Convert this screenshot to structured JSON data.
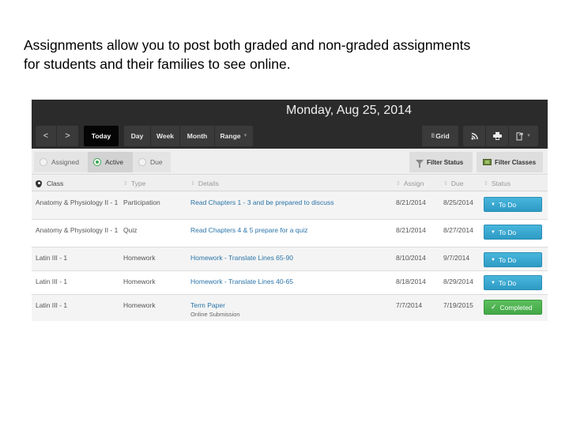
{
  "intro": {
    "line1": "Assignments allow you to post both graded and non-graded assignments",
    "line2": "for students and their families to see online."
  },
  "header": {
    "date_title": "Monday, Aug 25, 2014",
    "prev_label": "<",
    "next_label": ">",
    "today_label": "Today",
    "views": [
      {
        "label": "Day"
      },
      {
        "label": "Week"
      },
      {
        "label": "Month"
      },
      {
        "label": "Range"
      }
    ],
    "grid_label": "Grid",
    "icons": [
      "grid-icon",
      "rss-icon",
      "print-icon",
      "export-icon"
    ]
  },
  "filters": {
    "segments": [
      {
        "label": "Assigned",
        "selected": false
      },
      {
        "label": "Active",
        "selected": true
      },
      {
        "label": "Due",
        "selected": false
      }
    ],
    "filter_status_label": "Filter Status",
    "filter_classes_label": "Filter Classes"
  },
  "table": {
    "columns": {
      "class": "Class",
      "type": "Type",
      "details": "Details",
      "assign": "Assign",
      "due": "Due",
      "status": "Status"
    },
    "rows": [
      {
        "class": "Anatomy & Physiology II - 1",
        "type": "Participation",
        "details": "Read Chapters 1 - 3 and be prepared to discuss",
        "sub": "",
        "assign": "8/21/2014",
        "due": "8/25/2014",
        "status": "To Do"
      },
      {
        "class": "Anatomy & Physiology II - 1",
        "type": "Quiz",
        "details": "Read Chapters 4 & 5 prepare for a quiz",
        "sub": "",
        "assign": "8/21/2014",
        "due": "8/27/2014",
        "status": "To Do"
      },
      {
        "class": "Latin III - 1",
        "type": "Homework",
        "details": "Homework - Translate Lines 65-90",
        "sub": "",
        "assign": "8/10/2014",
        "due": "9/7/2014",
        "status": "To Do"
      },
      {
        "class": "Latin III - 1",
        "type": "Homework",
        "details": "Homework - Translate Lines 40-65",
        "sub": "",
        "assign": "8/18/2014",
        "due": "8/29/2014",
        "status": "To Do"
      },
      {
        "class": "Latin III - 1",
        "type": "Homework",
        "details": "Term Paper",
        "sub": "Online Submission",
        "assign": "7/7/2014",
        "due": "7/19/2015",
        "status": "Completed"
      }
    ]
  },
  "colors": {
    "todo": "#3aa9d2",
    "completed": "#4fb451",
    "link": "#2a74a8",
    "header_bg": "#2b2b2b"
  }
}
